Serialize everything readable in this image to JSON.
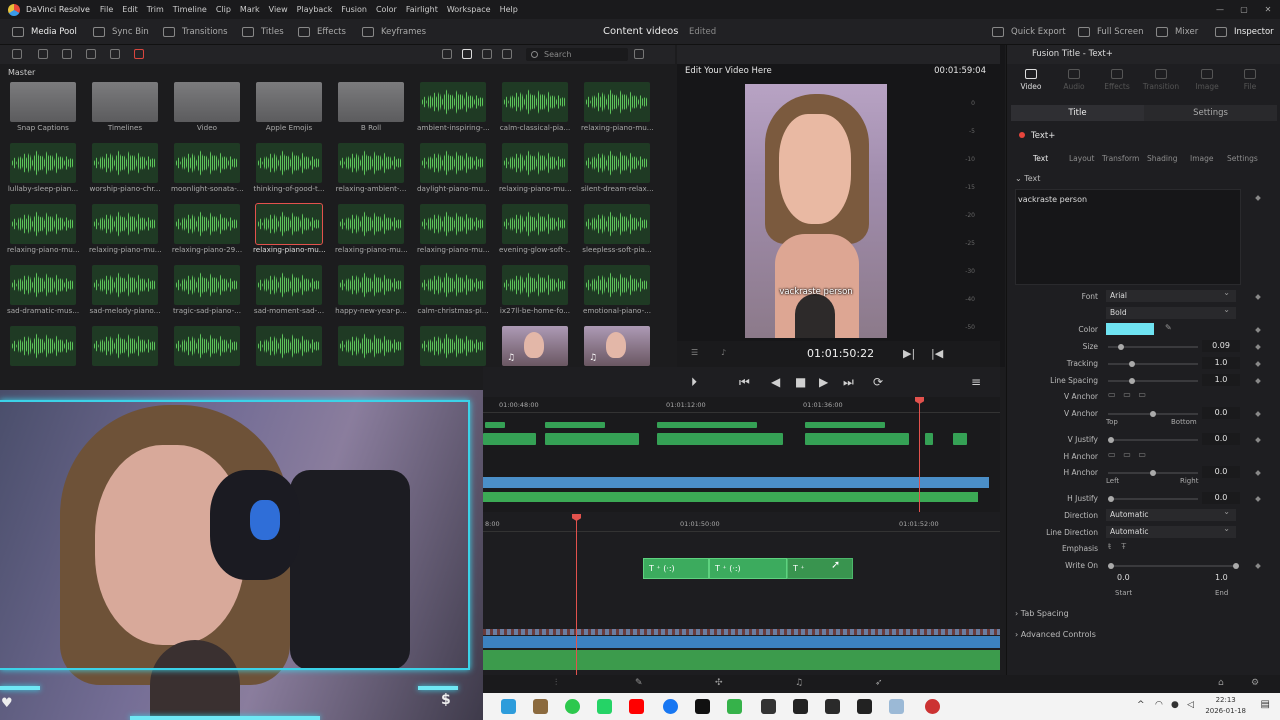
{
  "app": {
    "name": "DaVinci Resolve",
    "menu": [
      "File",
      "Edit",
      "Trim",
      "Timeline",
      "Clip",
      "Mark",
      "View",
      "Playback",
      "Fusion",
      "Color",
      "Fairlight",
      "Workspace",
      "Help"
    ],
    "window_controls": [
      "—",
      "▢",
      "✕"
    ]
  },
  "toolbar": {
    "media_pool": "Media Pool",
    "sync_bin": "Sync Bin",
    "transitions": "Transitions",
    "titles": "Titles",
    "effects": "Effects",
    "keyframes": "Keyframes",
    "project_title": "Content videos",
    "project_status": "Edited",
    "quick_export": "Quick Export",
    "full_screen": "Full Screen",
    "mixer": "Mixer",
    "inspector": "Inspector"
  },
  "media_pool": {
    "search_placeholder": "Search",
    "bin": "Master",
    "items": [
      {
        "label": "Snap Captions",
        "kind": "folder"
      },
      {
        "label": "Timelines",
        "kind": "folder"
      },
      {
        "label": "Video",
        "kind": "folder"
      },
      {
        "label": "Apple Emojis",
        "kind": "folder"
      },
      {
        "label": "B Roll",
        "kind": "folder"
      },
      {
        "label": "ambient-inspiring-...",
        "kind": "audio"
      },
      {
        "label": "calm-classical-pia...",
        "kind": "audio"
      },
      {
        "label": "relaxing-piano-mu...",
        "kind": "audio"
      },
      {
        "label": "lullaby-sleep-pian...",
        "kind": "audio"
      },
      {
        "label": "worship-piano-chr...",
        "kind": "audio"
      },
      {
        "label": "moonlight-sonata-...",
        "kind": "audio"
      },
      {
        "label": "thinking-of-good-t...",
        "kind": "audio"
      },
      {
        "label": "relaxing-ambient-...",
        "kind": "audio"
      },
      {
        "label": "daylight-piano-mu...",
        "kind": "audio"
      },
      {
        "label": "relaxing-piano-mu...",
        "kind": "audio"
      },
      {
        "label": "silent-dream-relax...",
        "kind": "audio"
      },
      {
        "label": "relaxing-piano-mu...",
        "kind": "audio"
      },
      {
        "label": "relaxing-piano-mu...",
        "kind": "audio"
      },
      {
        "label": "relaxing-piano-29...",
        "kind": "audio"
      },
      {
        "label": "relaxing-piano-mu...",
        "kind": "audio",
        "selected": true
      },
      {
        "label": "relaxing-piano-mu...",
        "kind": "audio"
      },
      {
        "label": "relaxing-piano-mu...",
        "kind": "audio"
      },
      {
        "label": "evening-glow-soft-...",
        "kind": "audio"
      },
      {
        "label": "sleepless-soft-pia...",
        "kind": "audio"
      },
      {
        "label": "sad-dramatic-mus...",
        "kind": "audio"
      },
      {
        "label": "sad-melody-piano...",
        "kind": "audio"
      },
      {
        "label": "tragic-sad-piano-...",
        "kind": "audio"
      },
      {
        "label": "sad-moment-sad-...",
        "kind": "audio"
      },
      {
        "label": "happy-new-year-p...",
        "kind": "audio"
      },
      {
        "label": "calm-christmas-pi...",
        "kind": "audio"
      },
      {
        "label": "ix27ll-be-home-fo...",
        "kind": "audio"
      },
      {
        "label": "emotional-piano-...",
        "kind": "audio"
      },
      {
        "label": "",
        "kind": "audio"
      },
      {
        "label": "",
        "kind": "audio"
      },
      {
        "label": "",
        "kind": "audio"
      },
      {
        "label": "",
        "kind": "audio"
      },
      {
        "label": "",
        "kind": "audio"
      },
      {
        "label": "",
        "kind": "audio"
      },
      {
        "label": "",
        "kind": "video"
      },
      {
        "label": "",
        "kind": "video"
      }
    ]
  },
  "viewer": {
    "title": "Edit Your Video Here",
    "duration": "00:01:59:04",
    "subtitle": "vackraste person",
    "timecode": "01:01:50:22",
    "meter_scale": [
      "0",
      "-5",
      "-10",
      "-15",
      "-20",
      "-25",
      "-30",
      "-40",
      "-50"
    ]
  },
  "inspector": {
    "header": "Fusion Title - Text+",
    "tabs": [
      "Video",
      "Audio",
      "Effects",
      "Transition",
      "Image",
      "File"
    ],
    "active_tab": "Video",
    "segments": [
      "Title",
      "Settings"
    ],
    "node_name": "Text+",
    "subtabs": [
      "Text",
      "Layout",
      "Transform",
      "Shading",
      "Image",
      "Settings"
    ],
    "section_text": "Text",
    "text_value": "vackraste person",
    "font_label": "Font",
    "font_value": "Arial",
    "font_style": "Bold",
    "color_label": "Color",
    "color_value": "#6fe3f2",
    "size_label": "Size",
    "size_value": "0.09",
    "size_level": 0.12,
    "tracking_label": "Tracking",
    "tracking_value": "1.0",
    "tracking_level": 0.25,
    "line_spacing_label": "Line Spacing",
    "line_spacing_value": "1.0",
    "line_spacing_level": 0.25,
    "v_anchor_label": "V Anchor",
    "v_anchor2_label": "V Anchor",
    "v_anchor_value": "0.0",
    "v_anchor_level": 0.5,
    "top_label": "Top",
    "bottom_label": "Bottom",
    "v_justify_label": "V Justify",
    "v_justify_value": "0.0",
    "h_anchor_label": "H Anchor",
    "h_anchor2_label": "H Anchor",
    "h_anchor_value": "0.0",
    "h_anchor_level": 0.5,
    "left_label": "Left",
    "right_label": "Right",
    "h_justify_label": "H Justify",
    "h_justify_value": "0.0",
    "direction_label": "Direction",
    "direction_value": "Automatic",
    "line_direction_label": "Line Direction",
    "line_direction_value": "Automatic",
    "emphasis_label": "Emphasis",
    "write_on_label": "Write On",
    "write_on_start": "0.0",
    "write_on_end": "1.0",
    "start_label": "Start",
    "end_label": "End",
    "tab_spacing": "Tab Spacing",
    "advanced_controls": "Advanced Controls"
  },
  "timeline": {
    "upper_ticks": [
      "01:00:48:00",
      "01:01:12:00",
      "01:01:36:00"
    ],
    "lower_ticks": [
      "8:00",
      "01:01:50:00",
      "01:01:52:00"
    ]
  },
  "overlay": {
    "heart": "♥",
    "dollar": "$"
  },
  "taskbar": {
    "time": "22:13",
    "date": "2026-01-18"
  }
}
